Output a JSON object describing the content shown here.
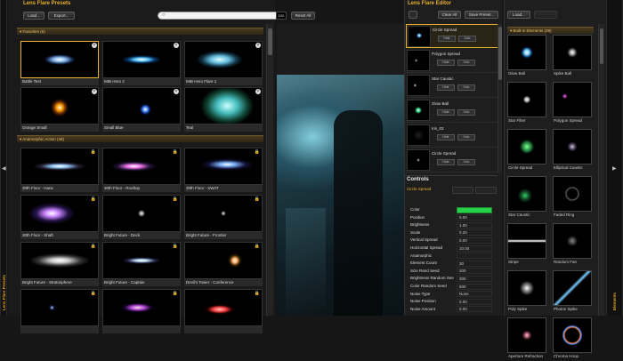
{
  "left_tab": {
    "label": "Lens Flare Presets"
  },
  "right_tab": {
    "label": "Elements"
  },
  "presets": {
    "title": "Lens Flare Presets",
    "load": "Load...",
    "export": "Export...",
    "search_placeholder": "",
    "size_value": "100",
    "reset_all": "Reset All",
    "favorites_header": "Favorites (6)",
    "favorites": [
      {
        "name": "Battle Test"
      },
      {
        "name": "MIB Hero 2"
      },
      {
        "name": "MIB Hero Flare 1"
      },
      {
        "name": "Orange Small"
      },
      {
        "name": "Small Blue"
      },
      {
        "name": "Teal"
      }
    ],
    "anamorphic_header": "Anamorphic Action (48)",
    "anamorphic": [
      {
        "name": "30th Floor - Hans"
      },
      {
        "name": "30th Floor - Rooftop"
      },
      {
        "name": "30th Floor - SWAT"
      },
      {
        "name": "30th Floor - Shaft"
      },
      {
        "name": "Bright Future - Deck"
      },
      {
        "name": "Bright Future - Frontier"
      },
      {
        "name": "Bright Future - Stratosphere"
      },
      {
        "name": "Bright Future - Captain"
      },
      {
        "name": "Devil's Tower - Conference"
      },
      {
        "name": ""
      },
      {
        "name": ""
      },
      {
        "name": ""
      }
    ]
  },
  "editor": {
    "title": "Lens Flare Editor",
    "clear_all": "Clear All",
    "save_preset": "Save Preset...",
    "hide": "Hide",
    "solo": "Solo",
    "elements": [
      {
        "name": "Circle Spread",
        "selected": true
      },
      {
        "name": "Polygon Spread",
        "selected": false
      },
      {
        "name": "Star Caustic",
        "selected": false
      },
      {
        "name": "Glow Ball",
        "selected": false
      },
      {
        "name": "Iris_03",
        "selected": false
      },
      {
        "name": "Circle Spread",
        "selected": false
      }
    ]
  },
  "controls": {
    "title": "Controls",
    "selected": "Circle Spread",
    "color_swatch": "#27d24a",
    "rows": [
      {
        "k": "Color",
        "v": ""
      },
      {
        "k": "Position",
        "v": "0.00"
      },
      {
        "k": "Brightness",
        "v": "1.00"
      },
      {
        "k": "Scale",
        "v": "0.20"
      },
      {
        "k": "Vertical Spread",
        "v": "0.00"
      },
      {
        "k": "Horizontal Spread",
        "v": "10.00"
      },
      {
        "k": "Anamorphic",
        "v": ""
      },
      {
        "k": "Element Count",
        "v": "30"
      },
      {
        "k": "Size Rand Seed",
        "v": "200"
      },
      {
        "k": "Brightness Random See",
        "v": "300"
      },
      {
        "k": "Color Random Seed",
        "v": "500"
      },
      {
        "k": "Noise Type",
        "v": "None"
      },
      {
        "k": "Noise Position",
        "v": "0.00"
      },
      {
        "k": "Noise Amount",
        "v": "0.00"
      }
    ]
  },
  "builtins": {
    "load": "Load...",
    "header": "Built-in Elements (29)",
    "items": [
      {
        "name": "Glow Ball"
      },
      {
        "name": "Spike Ball"
      },
      {
        "name": "Star Filter"
      },
      {
        "name": "Polygon Spread"
      },
      {
        "name": "Circle Spread"
      },
      {
        "name": "Elliptical Caustic"
      },
      {
        "name": "Star Caustic"
      },
      {
        "name": "Faded Ring"
      },
      {
        "name": "Stripe"
      },
      {
        "name": "Random Fan"
      },
      {
        "name": "Poly Spike"
      },
      {
        "name": "Photon Spike"
      },
      {
        "name": "Aperture Refraction"
      },
      {
        "name": "Chroma Hoop"
      }
    ]
  }
}
